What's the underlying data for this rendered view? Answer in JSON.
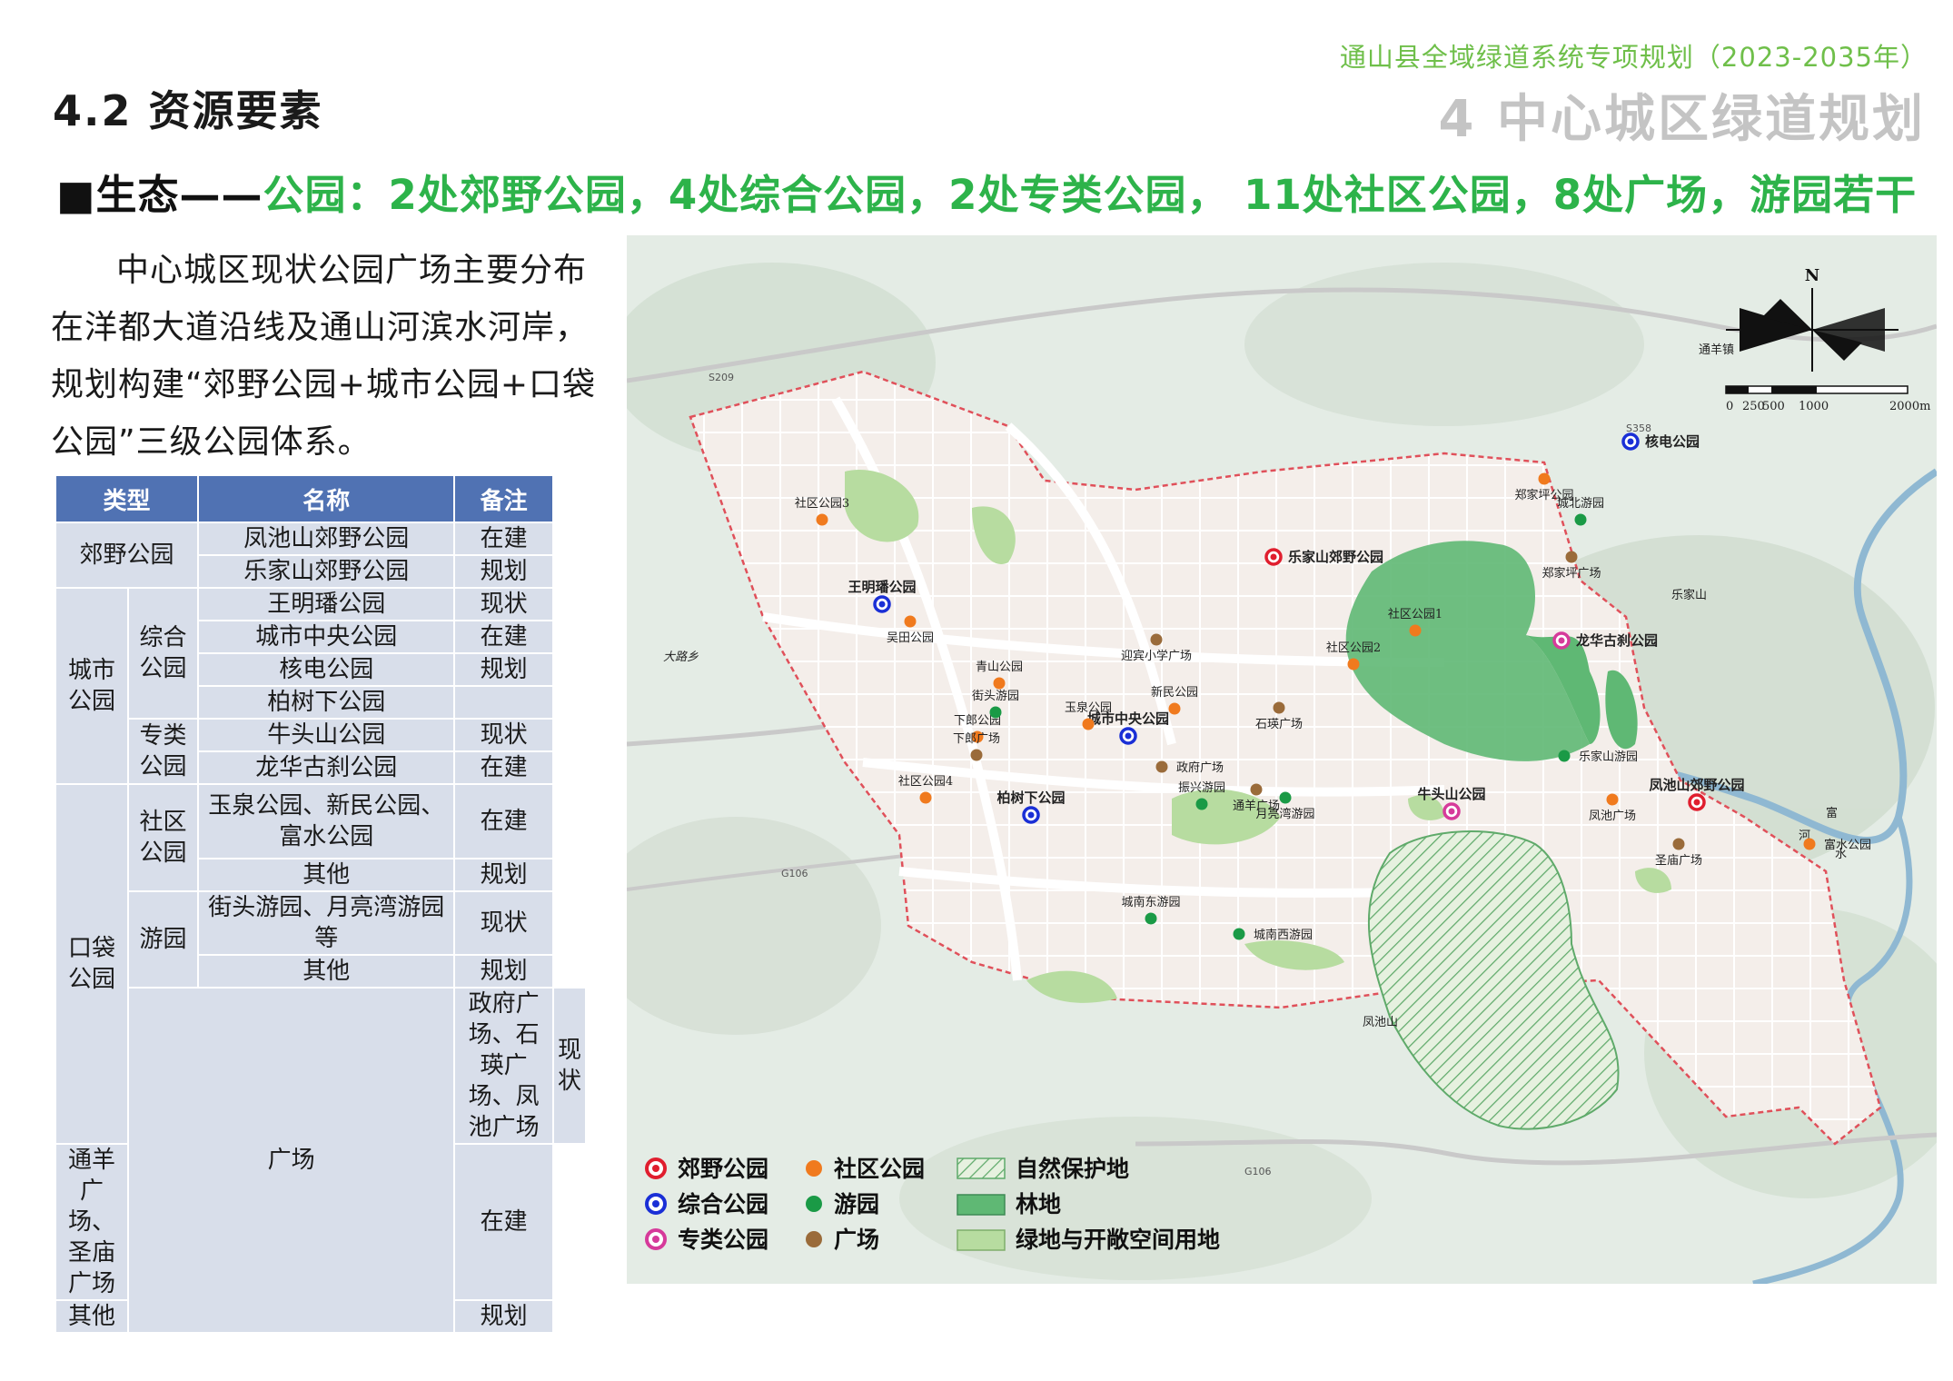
{
  "header": {
    "doc_title": "通山县全域绿道系统专项规划（2023-2035年）",
    "section": "4.2  资源要素",
    "chapter": "4  中心城区绿道规划"
  },
  "headline": {
    "prefix": "■生态——",
    "text": "公园：2处郊野公园，4处综合公园，2处专类公园， 11处社区公园，8处广场，游园若干"
  },
  "intro": {
    "text": "中心城区现状公园广场主要分布在洋都大道沿线及通山河滨水河岸，规划构建“郊野公园+城市公园+口袋公园”三级公园体系。"
  },
  "table": {
    "headers": [
      "类型",
      "名称",
      "备注"
    ],
    "g1": "郊野公园",
    "r1": [
      "凤池山郊野公园",
      "在建"
    ],
    "r2": [
      "乐家山郊野公园",
      "规划"
    ],
    "g2": "城市公园",
    "s1": "综合公园",
    "r3": [
      "王明璠公园",
      "现状"
    ],
    "r4": [
      "城市中央公园",
      "在建"
    ],
    "r5": [
      "核电公园",
      "规划"
    ],
    "r6": [
      "柏树下公园",
      ""
    ],
    "s2": "专类公园",
    "r7": [
      "牛头山公园",
      "现状"
    ],
    "r8": [
      "龙华古刹公园",
      "在建"
    ],
    "g3": "口袋公园",
    "s3": "社区公园",
    "r9": [
      "玉泉公园、新民公园、富水公园",
      "在建"
    ],
    "r10": [
      "其他",
      "规划"
    ],
    "s4": "游园",
    "r11": [
      "街头游园、月亮湾游园等",
      "现状"
    ],
    "r12": [
      "其他",
      "规划"
    ],
    "g4": "广场",
    "r13": [
      "政府广场、石瑛广场、凤池广场",
      "现状"
    ],
    "r14": [
      "通羊广场、圣庙广场",
      "在建"
    ],
    "r15": [
      "其他",
      "规划"
    ]
  },
  "map": {
    "compass_n": "N",
    "scale_labels": [
      "0",
      "250",
      "500",
      "1000",
      "2000m"
    ],
    "place_names": [
      "乐家山",
      "大路乡",
      "凤池山",
      "通羊镇",
      "富",
      "河",
      "水"
    ],
    "road_names": [
      "S209",
      "S358",
      "G106",
      "G106"
    ],
    "markers": {
      "country": [
        "乐家山郊野公园",
        "凤池山郊野公园"
      ],
      "comprehensive": [
        "核电公园",
        "王明璠公园",
        "城市中央公园",
        "柏树下公园"
      ],
      "special": [
        "龙华古刹公园",
        "牛头山公园"
      ],
      "community": [
        "社区公园3",
        "郑家坪公园",
        "吴田公园",
        "社区公园1",
        "社区公园2",
        "青山公园",
        "下郎公园",
        "玉泉公园",
        "新民公园",
        "社区公园4",
        "凤池广场",
        "富水公园"
      ],
      "garden": [
        "城北游园",
        "街头游园",
        "振兴游园",
        "月亮湾游园",
        "城南东游园",
        "城南西游园",
        "乐家山游园"
      ],
      "plaza": [
        "郑家坪广场",
        "迎宾小学广场",
        "石瑛广场",
        "下郎广场",
        "政府广场",
        "通羊广场",
        "圣庙广场"
      ]
    },
    "legend": {
      "country": "郊野公园",
      "comprehensive": "综合公园",
      "special": "专类公园",
      "community": "社区公园",
      "garden": "游园",
      "plaza": "广场",
      "reserve": "自然保护地",
      "forest": "林地",
      "green": "绿地与开敞空间用地"
    },
    "colors": {
      "country": "#e01e2e",
      "comprehensive": "#1a2fd6",
      "special": "#d63a9a",
      "community": "#f07a1e",
      "garden": "#1a9a46",
      "plaza": "#9a6b3a",
      "forest": "#5fb874",
      "green": "#b7dca0",
      "boundary": "#e0505a"
    }
  }
}
